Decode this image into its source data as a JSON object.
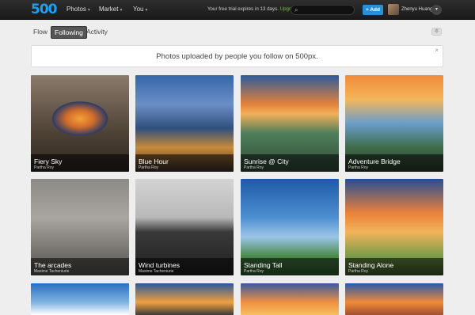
{
  "header": {
    "logo": "500",
    "nav": [
      {
        "label": "Photos"
      },
      {
        "label": "Market"
      },
      {
        "label": "You"
      }
    ],
    "trial_text": "Your free trial expires in 13 days.",
    "upgrade_label": "Upgrade",
    "add_label": "+ Add",
    "username": "Zhenyu Huang"
  },
  "subnav": {
    "tabs": [
      {
        "label": "Flow"
      },
      {
        "label": "Following"
      },
      {
        "label": "Activity"
      }
    ]
  },
  "banner": {
    "text": "Photos uploaded by people you follow on 500px.",
    "close": "×"
  },
  "photos": [
    {
      "title": "Fiery Sky",
      "author": "Partha Roy"
    },
    {
      "title": "Blue Hour",
      "author": "Partha Roy"
    },
    {
      "title": "Sunrise @ City",
      "author": "Partha Roy"
    },
    {
      "title": "Adventure Bridge",
      "author": "Partha Roy"
    },
    {
      "title": "The arcades",
      "author": "Maxime Tacheniurie"
    },
    {
      "title": "Wind turbines",
      "author": "Maxime Tacheniurie"
    },
    {
      "title": "Standing Tall",
      "author": "Partha Roy"
    },
    {
      "title": "Standing Alone",
      "author": "Partha Roy"
    },
    {
      "title": "",
      "author": ""
    },
    {
      "title": "",
      "author": ""
    },
    {
      "title": "",
      "author": ""
    },
    {
      "title": "",
      "author": ""
    }
  ]
}
